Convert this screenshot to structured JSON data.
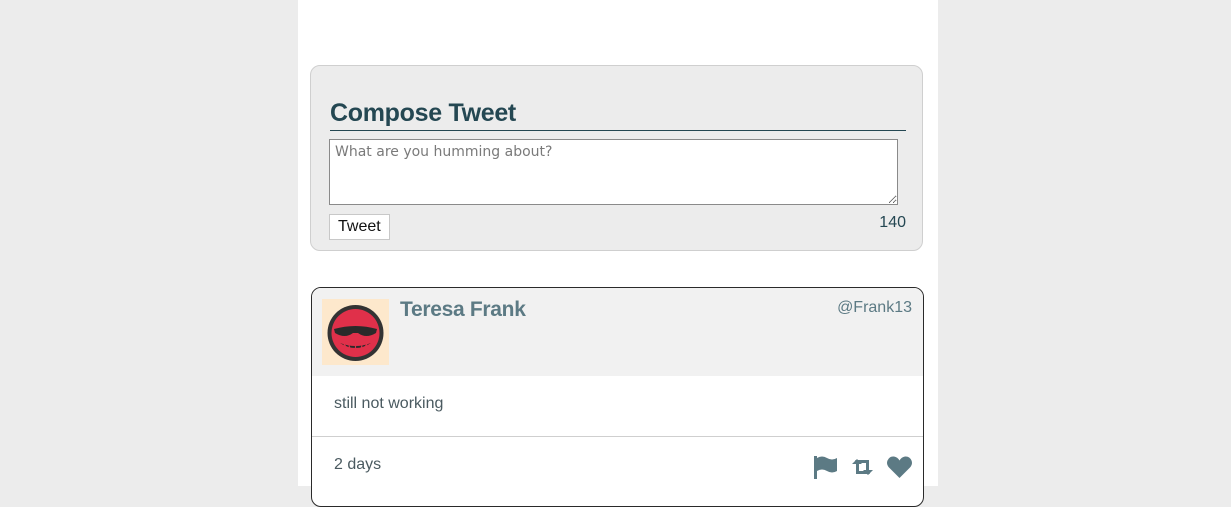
{
  "compose": {
    "title": "Compose Tweet",
    "placeholder": "What are you humming about?",
    "value": "",
    "button_label": "Tweet",
    "counter": "140"
  },
  "tweets": [
    {
      "author_name": "Teresa Frank",
      "handle": "@Frank13",
      "text": "still not working",
      "time": "2 days",
      "avatar_icon": "red-sunglasses-face-avatar",
      "actions": [
        "flag-icon",
        "retweet-icon",
        "heart-icon"
      ]
    }
  ],
  "colors": {
    "page_background": "#ececec",
    "accent": "#244752",
    "muted_text": "#5c7a84"
  }
}
